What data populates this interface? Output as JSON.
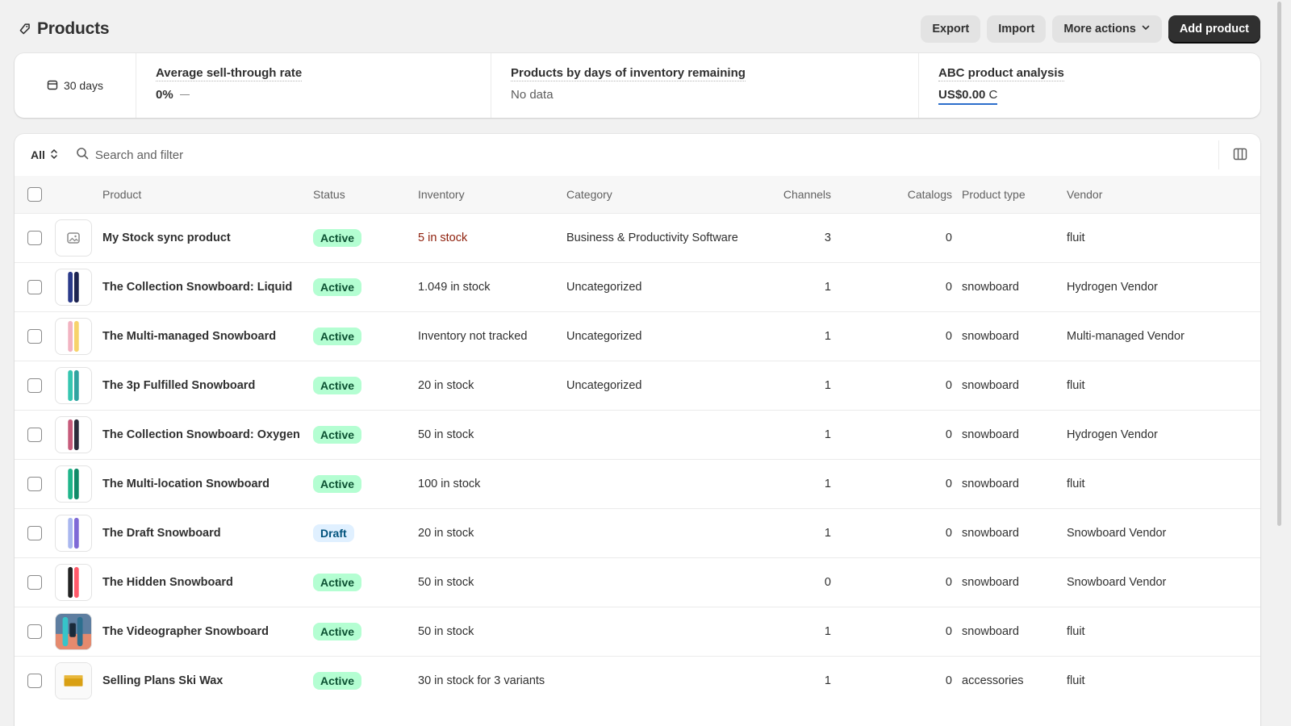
{
  "header": {
    "title": "Products",
    "export_label": "Export",
    "import_label": "Import",
    "more_actions_label": "More actions",
    "add_product_label": "Add product"
  },
  "metrics": {
    "period": "30 days",
    "sell_through": {
      "label": "Average sell-through rate",
      "value": "0%"
    },
    "days_inventory": {
      "label": "Products by days of inventory remaining",
      "value": "No data"
    },
    "abc": {
      "label": "ABC product analysis",
      "value": "US$0.00",
      "unit_char": "C"
    }
  },
  "toolbar": {
    "filter_label": "All",
    "search_placeholder": "Search and filter"
  },
  "columns": {
    "product": "Product",
    "status": "Status",
    "inventory": "Inventory",
    "category": "Category",
    "channels": "Channels",
    "catalogs": "Catalogs",
    "product_type": "Product type",
    "vendor": "Vendor"
  },
  "colors": {
    "primary_button": "#303030",
    "active_badge_bg": "#b4fed2",
    "active_badge_fg": "#0c5132",
    "draft_badge_bg": "#e0f0ff",
    "inventory_warning": "#8e1f0b",
    "link_underline": "#2c6ecb"
  },
  "rows": [
    {
      "name": "My Stock sync product",
      "status": "Active",
      "inventory": "5 in stock",
      "category": "Business & Productivity Software",
      "channels": "3",
      "catalogs": "0",
      "product_type": "",
      "vendor": "fluit",
      "thumb": "image-placeholder-icon"
    },
    {
      "name": "The Collection Snowboard: Liquid",
      "status": "Active",
      "inventory": "1.049 in stock",
      "category": "Uncategorized",
      "channels": "1",
      "catalogs": "0",
      "product_type": "snowboard",
      "vendor": "Hydrogen Vendor",
      "thumb": "snowboard-liquid"
    },
    {
      "name": "The Multi-managed Snowboard",
      "status": "Active",
      "inventory": "Inventory not tracked",
      "category": "Uncategorized",
      "channels": "1",
      "catalogs": "0",
      "product_type": "snowboard",
      "vendor": "Multi-managed Vendor",
      "thumb": "snowboard-multi-managed"
    },
    {
      "name": "The 3p Fulfilled Snowboard",
      "status": "Active",
      "inventory": "20 in stock",
      "category": "Uncategorized",
      "channels": "1",
      "catalogs": "0",
      "product_type": "snowboard",
      "vendor": "fluit",
      "thumb": "snowboard-3p"
    },
    {
      "name": "The Collection Snowboard: Oxygen",
      "status": "Active",
      "inventory": "50 in stock",
      "category": "",
      "channels": "1",
      "catalogs": "0",
      "product_type": "snowboard",
      "vendor": "Hydrogen Vendor",
      "thumb": "snowboard-oxygen"
    },
    {
      "name": "The Multi-location Snowboard",
      "status": "Active",
      "inventory": "100 in stock",
      "category": "",
      "channels": "1",
      "catalogs": "0",
      "product_type": "snowboard",
      "vendor": "fluit",
      "thumb": "snowboard-multi-location"
    },
    {
      "name": "The Draft Snowboard",
      "status": "Draft",
      "inventory": "20 in stock",
      "category": "",
      "channels": "1",
      "catalogs": "0",
      "product_type": "snowboard",
      "vendor": "Snowboard Vendor",
      "thumb": "snowboard-draft"
    },
    {
      "name": "The Hidden Snowboard",
      "status": "Active",
      "inventory": "50 in stock",
      "category": "",
      "channels": "0",
      "catalogs": "0",
      "product_type": "snowboard",
      "vendor": "Snowboard Vendor",
      "thumb": "snowboard-hidden"
    },
    {
      "name": "The Videographer Snowboard",
      "status": "Active",
      "inventory": "50 in stock",
      "category": "",
      "channels": "1",
      "catalogs": "0",
      "product_type": "snowboard",
      "vendor": "fluit",
      "thumb": "snowboard-videographer"
    },
    {
      "name": "Selling Plans Ski Wax",
      "status": "Active",
      "inventory": "30 in stock for 3 variants",
      "category": "",
      "channels": "1",
      "catalogs": "0",
      "product_type": "accessories",
      "vendor": "fluit",
      "thumb": "ski-wax"
    }
  ]
}
